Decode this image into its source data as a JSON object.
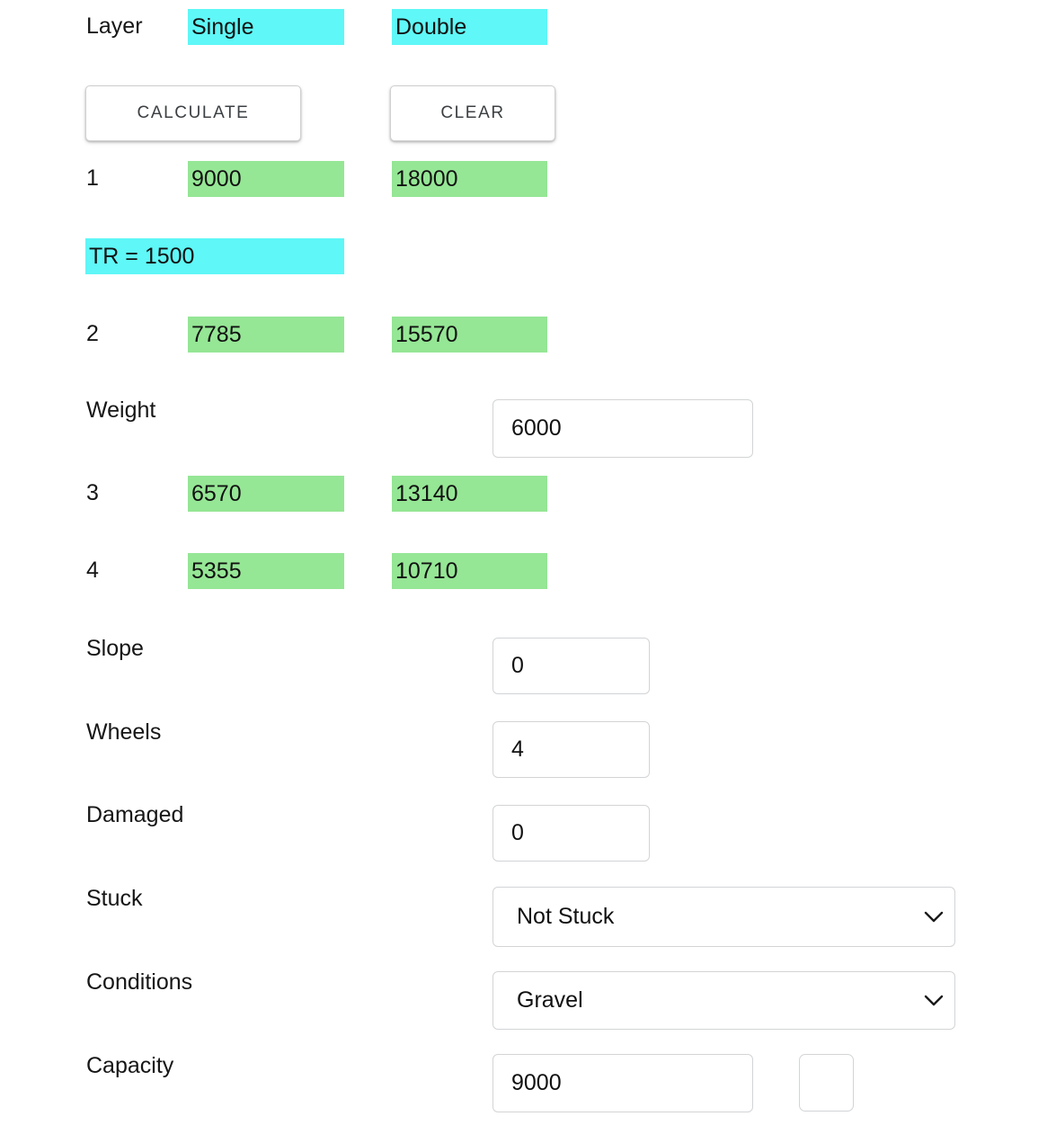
{
  "layer_row": {
    "label": "Layer",
    "single": "Single",
    "double": "Double"
  },
  "buttons": {
    "calculate": "CALCULATE",
    "clear": "CLEAR"
  },
  "tr_note": "TR = 1500",
  "axle_rows": [
    {
      "num": "1",
      "single": "9000",
      "double": "18000"
    },
    {
      "num": "2",
      "single": "7785",
      "double": "15570"
    },
    {
      "num": "3",
      "single": "6570",
      "double": "13140"
    },
    {
      "num": "4",
      "single": "5355",
      "double": "10710"
    }
  ],
  "fields": {
    "weight": {
      "label": "Weight",
      "value": "6000",
      "placeholder": ""
    },
    "slope": {
      "label": "Slope",
      "value": "0",
      "placeholder": ""
    },
    "wheels": {
      "label": "Wheels",
      "value": "4",
      "placeholder": ""
    },
    "damaged": {
      "label": "Damaged",
      "value": "0",
      "placeholder": ""
    },
    "stuck": {
      "label": "Stuck",
      "value": "Not Stuck"
    },
    "conditions": {
      "label": "Conditions",
      "value": "Gravel"
    },
    "capacity": {
      "label": "Capacity",
      "value": "9000",
      "placeholder": "",
      "extra_value": ""
    }
  },
  "colors": {
    "cyan_highlight": "#5ff7f7",
    "green_highlight": "#95e695",
    "text": "#161616",
    "border": "#d2d4d6"
  }
}
